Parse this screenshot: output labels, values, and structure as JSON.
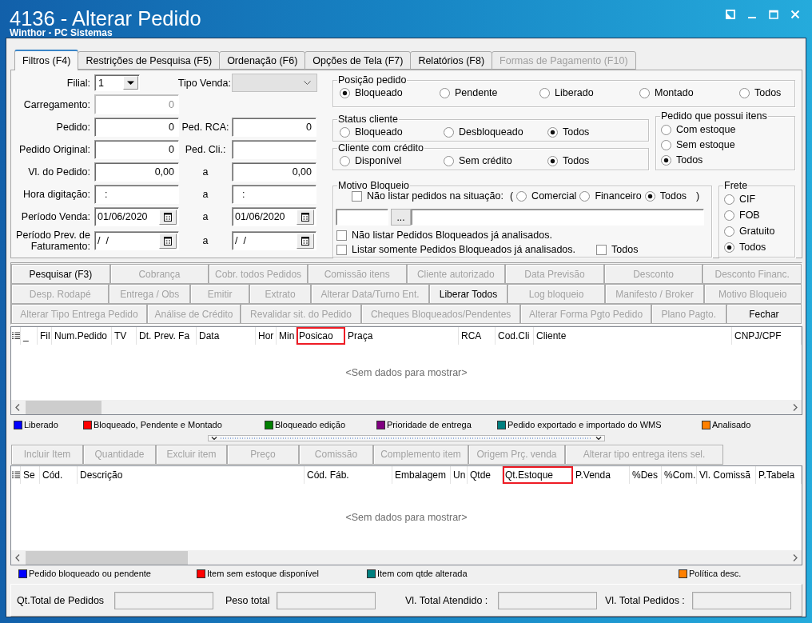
{
  "window": {
    "title": "4136 - Alterar Pedido",
    "subtitle": "Winthor - PC Sistemas"
  },
  "tabs": [
    {
      "label": "Filtros (F4)",
      "selected": true,
      "disabled": false
    },
    {
      "label": "Restrições de Pesquisa (F5)",
      "selected": false,
      "disabled": false
    },
    {
      "label": "Ordenação (F6)",
      "selected": false,
      "disabled": false
    },
    {
      "label": "Opções de Tela (F7)",
      "selected": false,
      "disabled": false
    },
    {
      "label": "Relatórios (F8)",
      "selected": false,
      "disabled": false
    },
    {
      "label": "Formas de Pagamento (F10)",
      "selected": false,
      "disabled": true
    }
  ],
  "filter_form": {
    "filial": {
      "label": "Filial:",
      "value": "1"
    },
    "tipo_venda": {
      "label": "Tipo Venda:",
      "disabled": true
    },
    "rows": [
      {
        "label": "Carregamento:",
        "field": {
          "kind": "number",
          "value": "0",
          "disabled": true
        }
      },
      {
        "label": "Pedido:",
        "field": {
          "kind": "number",
          "value": "0",
          "disabled": false
        },
        "second_label": "Ped. RCA:",
        "second_field": {
          "kind": "number",
          "value": "0",
          "disabled": false
        }
      },
      {
        "label": "Pedido Original:",
        "field": {
          "kind": "number",
          "value": "0",
          "disabled": false
        },
        "second_label": "Ped. Cli.:",
        "second_field": {
          "kind": "text",
          "disabled": false
        }
      },
      {
        "label": "Vl. do Pedido:",
        "field": {
          "kind": "number",
          "value": "0,00",
          "disabled": false
        },
        "second_label": "a",
        "second_field": {
          "kind": "number",
          "value": "0,00",
          "disabled": false
        }
      },
      {
        "label": "Hora digitação:",
        "field": {
          "kind": "time",
          "value": ":",
          "disabled": false
        },
        "second_label": "a",
        "second_field": {
          "kind": "time",
          "value": ":",
          "disabled": false
        }
      },
      {
        "label": "Período Venda:",
        "field": {
          "kind": "date",
          "value": "01/06/2020",
          "disabled": false
        },
        "second_label": "a",
        "second_field": {
          "kind": "date",
          "value": "01/06/2020",
          "disabled": false
        }
      },
      {
        "label": "Período Prev. de Faturamento:",
        "field": {
          "kind": "date",
          "value": "/  /",
          "disabled": false
        },
        "second_label": "a",
        "second_field": {
          "kind": "date",
          "value": "/  /",
          "disabled": false
        }
      }
    ]
  },
  "filter_options": {
    "posicao_pedido": {
      "title": "Posição pedido",
      "options": [
        {
          "label": "Bloqueado",
          "selected": true
        },
        {
          "label": "Pendente",
          "selected": false
        },
        {
          "label": "Liberado",
          "selected": false
        },
        {
          "label": "Montado",
          "selected": false
        },
        {
          "label": "Todos",
          "selected": false
        }
      ]
    },
    "status_cliente": {
      "title": "Status cliente",
      "options": [
        {
          "label": "Bloqueado",
          "selected": false
        },
        {
          "label": "Desbloqueado",
          "selected": false
        },
        {
          "label": "Todos",
          "selected": true
        }
      ]
    },
    "cliente_com_credito": {
      "title": "Cliente com crédito",
      "options": [
        {
          "label": "Disponível",
          "selected": false
        },
        {
          "label": "Sem crédito",
          "selected": false
        },
        {
          "label": "Todos",
          "selected": true
        }
      ]
    },
    "pedido_que_possui_itens": {
      "title": "Pedido que possui itens",
      "options": [
        {
          "label": "Com estoque",
          "selected": false
        },
        {
          "label": "Sem estoque",
          "selected": false
        },
        {
          "label": "Todos",
          "selected": true
        }
      ]
    },
    "motivo_bloqueio": {
      "title": "Motivo Bloqueio",
      "exclude_check": {
        "label": "Não listar pedidos na situação:",
        "checked": false
      },
      "open_paren": "(",
      "situations": [
        {
          "label": "Comercial",
          "selected": false
        },
        {
          "label": "Financeiro",
          "selected": false
        },
        {
          "label": "Todos",
          "selected": true
        }
      ],
      "close_paren": ")",
      "lookup_button": "...",
      "checks": [
        {
          "label": "Não listar Pedidos Bloqueados já analisados.",
          "checked": false
        },
        {
          "label": "Listar somente Pedidos Bloqueados já analisados.",
          "checked": false
        }
      ],
      "todos_check": {
        "label": "Todos",
        "checked": false
      }
    },
    "frete": {
      "title": "Frete",
      "options": [
        {
          "label": "CIF",
          "selected": false
        },
        {
          "label": "FOB",
          "selected": false
        },
        {
          "label": "Gratuito",
          "selected": false
        },
        {
          "label": "Todos",
          "selected": true
        }
      ]
    }
  },
  "action_buttons": [
    {
      "buttons": [
        {
          "label": "Pesquisar (F3)",
          "disabled": false
        },
        {
          "label": "Cobrança",
          "disabled": true
        },
        {
          "label": "Cobr. todos Pedidos",
          "disabled": true
        },
        {
          "label": "Comissão itens",
          "disabled": true
        },
        {
          "label": "Cliente autorizado",
          "disabled": true
        },
        {
          "label": "Data Previsão",
          "disabled": true
        },
        {
          "label": "Desconto",
          "disabled": true
        },
        {
          "label": "Desconto Financ.",
          "disabled": true
        }
      ]
    },
    {
      "buttons": [
        {
          "label": "Desp. Rodapé",
          "disabled": true
        },
        {
          "label": "Entrega / Obs",
          "disabled": true
        },
        {
          "label": "Emitir",
          "disabled": true
        },
        {
          "label": "Extrato",
          "disabled": true
        },
        {
          "label": "Alterar Data/Turno Ent.",
          "disabled": true
        },
        {
          "label": "Liberar Todos",
          "disabled": false
        },
        {
          "label": "Log bloqueio",
          "disabled": true
        },
        {
          "label": "Manifesto / Broker",
          "disabled": true
        },
        {
          "label": "Motivo Bloqueio",
          "disabled": true
        }
      ]
    },
    {
      "buttons": [
        {
          "label": "Alterar Tipo Entrega Pedido",
          "disabled": true
        },
        {
          "label": "Análise de Crédito",
          "disabled": true
        },
        {
          "label": "Revalidar sit. do Pedido",
          "disabled": true
        },
        {
          "label": "Cheques Bloqueados/Pendentes",
          "disabled": true
        },
        {
          "label": "Alterar Forma Pgto Pedido",
          "disabled": true
        },
        {
          "label": "Plano Pagto.",
          "disabled": true
        },
        {
          "label": "Fechar",
          "disabled": false
        }
      ]
    }
  ],
  "orders_grid": {
    "columns": [
      {
        "label": "_",
        "highlighted": false
      },
      {
        "label": "Fil",
        "highlighted": false
      },
      {
        "label": "Num.Pedido",
        "highlighted": false
      },
      {
        "label": "TV",
        "highlighted": false
      },
      {
        "label": "Dt. Prev. Fa",
        "highlighted": false
      },
      {
        "label": "Data",
        "highlighted": false
      },
      {
        "label": "Hor",
        "highlighted": false
      },
      {
        "label": "Min",
        "highlighted": false
      },
      {
        "label": "Posicao",
        "highlighted": true
      },
      {
        "label": "Praça",
        "highlighted": false
      },
      {
        "label": "RCA",
        "highlighted": false
      },
      {
        "label": "Cod.Cli",
        "highlighted": false
      },
      {
        "label": "Cliente",
        "highlighted": false
      },
      {
        "label": "CNPJ/CPF",
        "highlighted": false
      }
    ],
    "empty_text": "<Sem dados para mostrar>"
  },
  "order_legend": [
    {
      "label": "Liberado",
      "color": "#0000ff"
    },
    {
      "label": "Bloqueado, Pendente e Montado",
      "color": "#ff0000"
    },
    {
      "label": "Bloqueado edição",
      "color": "#008000"
    },
    {
      "label": "Prioridade de entrega",
      "color": "#800080"
    },
    {
      "label": "Pedido exportado e importado do WMS",
      "color": "#008080"
    },
    {
      "label": "Analisado",
      "color": "#ff8000"
    }
  ],
  "item_buttons": [
    {
      "label": "Incluir Item",
      "disabled": true
    },
    {
      "label": "Quantidade",
      "disabled": true
    },
    {
      "label": "Excluir item",
      "disabled": true
    },
    {
      "label": "Preço",
      "disabled": true
    },
    {
      "label": "Comissão",
      "disabled": true
    },
    {
      "label": "Complemento item",
      "disabled": true
    },
    {
      "label": "Origem Prç. venda",
      "disabled": true
    },
    {
      "label": "Alterar tipo entrega itens sel.",
      "disabled": true
    }
  ],
  "items_grid": {
    "columns": [
      {
        "label": "Se",
        "highlighted": false
      },
      {
        "label": "Cód.",
        "highlighted": false
      },
      {
        "label": "Descrição",
        "highlighted": false
      },
      {
        "label": "Cód. Fáb.",
        "highlighted": false
      },
      {
        "label": "Embalagem",
        "highlighted": false
      },
      {
        "label": "Un",
        "highlighted": false
      },
      {
        "label": "Qtde",
        "highlighted": false
      },
      {
        "label": "Qt.Estoque",
        "highlighted": true
      },
      {
        "label": "P.Venda",
        "highlighted": false
      },
      {
        "label": "%Des",
        "highlighted": false
      },
      {
        "label": "%Com.",
        "highlighted": false
      },
      {
        "label": "Vl. Comissã",
        "highlighted": false
      },
      {
        "label": "P.Tabela",
        "highlighted": false
      }
    ],
    "empty_text": "<Sem dados para mostrar>"
  },
  "item_legend": [
    {
      "label": "Pedido bloqueado ou pendente",
      "color": "#0000ff"
    },
    {
      "label": "Item sem estoque disponível",
      "color": "#ff0000"
    },
    {
      "label": "Item com qtde alterada",
      "color": "#008080"
    },
    {
      "label": "Política desc.",
      "color": "#ff8000"
    }
  ],
  "totals": [
    {
      "label": "Qt.Total de Pedidos"
    },
    {
      "label": "Peso total"
    },
    {
      "label": "Vl. Total Atendido :"
    },
    {
      "label": "Vl. Total Pedidos :"
    }
  ]
}
